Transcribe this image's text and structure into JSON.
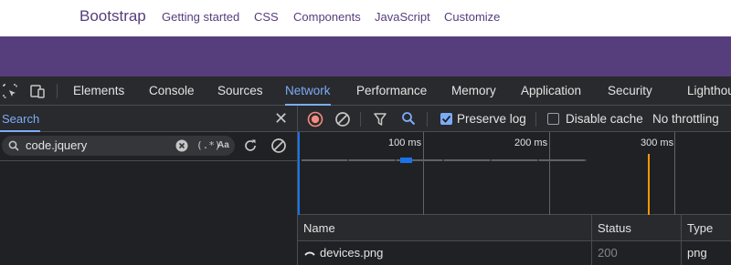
{
  "site": {
    "brand": "Bootstrap",
    "nav": [
      "Getting started",
      "CSS",
      "Components",
      "JavaScript",
      "Customize"
    ],
    "colors": {
      "brand_purple": "#563d7c"
    }
  },
  "devtools": {
    "tabs": [
      "Elements",
      "Console",
      "Sources",
      "Network",
      "Performance",
      "Memory",
      "Application",
      "Security",
      "Lighthou"
    ],
    "active_tab": "Network",
    "search": {
      "title": "Search",
      "query": "code.jquery",
      "regex_label": "(.*)",
      "match_case_label": "Aa"
    },
    "toolbar": {
      "preserve_log": {
        "label": "Preserve log",
        "checked": true
      },
      "disable_cache": {
        "label": "Disable cache",
        "checked": false
      },
      "throttling": "No throttling"
    },
    "overview": {
      "ticks": [
        "100 ms",
        "200 ms",
        "300 ms"
      ]
    },
    "table": {
      "columns": [
        "Name",
        "Status",
        "Type"
      ],
      "rows": [
        {
          "name": "devices.png",
          "status": "200",
          "type": "png"
        }
      ]
    },
    "colors": {
      "background": "#202124",
      "toolbar": "#292a2d",
      "accent": "#7cacf8",
      "record_red": "#f28b82",
      "divider": "#494c50",
      "timeline_orange": "#f29900"
    }
  }
}
